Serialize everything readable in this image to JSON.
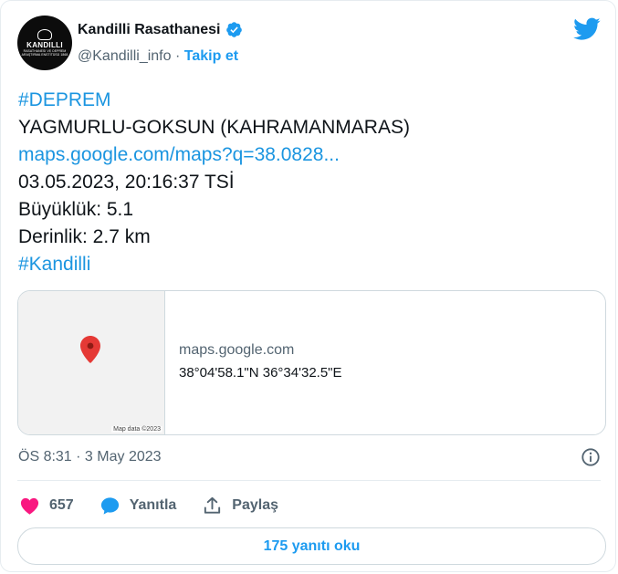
{
  "author": {
    "display_name": "Kandilli Rasathanesi",
    "handle": "@Kandilli_info",
    "separator": "·",
    "follow_label": "Takip et",
    "avatar_text_main": "KANDILLI",
    "avatar_text_sub": "RASATHANESI VE DEPREM ARAŞTIRMA ENSTİTÜSÜ 1868"
  },
  "tweet": {
    "lines": [
      "#DEPREM",
      "YAGMURLU-GOKSUN (KAHRAMANMARAS)",
      "maps.google.com/maps?q=38.0828...",
      "03.05.2023, 20:16:37 TSİ",
      "Büyüklük: 5.1",
      "Derinlik: 2.7 km",
      "#Kandilli"
    ]
  },
  "card": {
    "domain": "maps.google.com",
    "description": "38°04'58.1\"N 36°34'32.5\"E",
    "map_attribution": "Map data ©2023"
  },
  "meta": {
    "timestamp": "ÖS 8:31 · 3 May 2023"
  },
  "actions": {
    "like_count": "657",
    "reply_label": "Yanıtla",
    "share_label": "Paylaş"
  },
  "replies_button": "175 yanıtı oku",
  "colors": {
    "accent": "#1d9bf0",
    "link": "#1b95e0",
    "like": "#f91880",
    "pin": "#e53935"
  },
  "icons": [
    "verified-badge-icon",
    "twitter-bird-icon",
    "map-pin-icon",
    "info-icon",
    "heart-icon",
    "reply-bubble-icon",
    "share-icon"
  ]
}
